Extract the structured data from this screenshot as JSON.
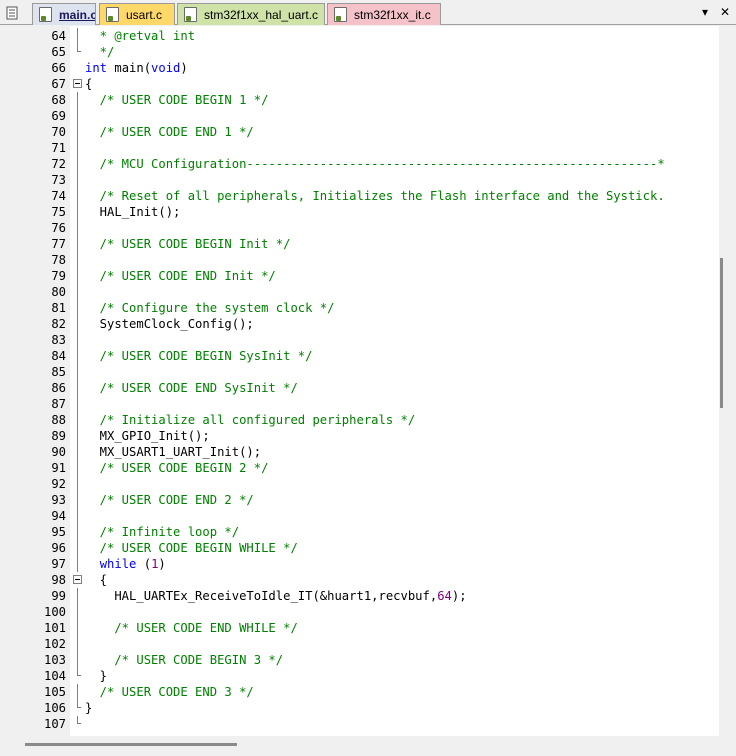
{
  "tabs": [
    {
      "label": "main.c",
      "active": true,
      "color": "#dde3ef"
    },
    {
      "label": "usart.c",
      "active": false,
      "color": "#ffd86a"
    },
    {
      "label": "stm32f1xx_hal_uart.c",
      "active": false,
      "color": "#cfe3a8"
    },
    {
      "label": "stm32f1xx_it.c",
      "active": false,
      "color": "#f4c2c8"
    }
  ],
  "controls": {
    "dropdown_icon": "chevron-down-icon",
    "close_icon": "close-icon",
    "dropdown_glyph": "▾",
    "close_glyph": "✕"
  },
  "colors": {
    "comment": "#008000",
    "keyword": "#0000ff",
    "number": "#800080",
    "text": "#000000"
  },
  "lines": [
    {
      "n": "64",
      "fold": "line",
      "segs": [
        {
          "t": "  * @retval int",
          "c": "cm"
        }
      ]
    },
    {
      "n": "65",
      "fold": "end",
      "segs": [
        {
          "t": "  */",
          "c": "cm"
        }
      ]
    },
    {
      "n": "66",
      "fold": "",
      "segs": [
        {
          "t": "int",
          "c": "kw"
        },
        {
          "t": " main(",
          "c": ""
        },
        {
          "t": "void",
          "c": "kw"
        },
        {
          "t": ")",
          "c": ""
        }
      ]
    },
    {
      "n": "67",
      "fold": "box",
      "segs": [
        {
          "t": "{",
          "c": ""
        }
      ]
    },
    {
      "n": "68",
      "fold": "line",
      "segs": [
        {
          "t": "  /* USER CODE BEGIN 1 */",
          "c": "cm"
        }
      ]
    },
    {
      "n": "69",
      "fold": "line",
      "segs": []
    },
    {
      "n": "70",
      "fold": "line",
      "segs": [
        {
          "t": "  /* USER CODE END 1 */",
          "c": "cm"
        }
      ]
    },
    {
      "n": "71",
      "fold": "line",
      "segs": []
    },
    {
      "n": "72",
      "fold": "line",
      "segs": [
        {
          "t": "  /* MCU Configuration--------------------------------------------------------*",
          "c": "cm"
        }
      ]
    },
    {
      "n": "73",
      "fold": "line",
      "segs": []
    },
    {
      "n": "74",
      "fold": "line",
      "segs": [
        {
          "t": "  /* Reset of all peripherals, Initializes the Flash interface and the Systick.",
          "c": "cm"
        }
      ]
    },
    {
      "n": "75",
      "fold": "line",
      "segs": [
        {
          "t": "  HAL_Init();",
          "c": ""
        }
      ]
    },
    {
      "n": "76",
      "fold": "line",
      "segs": []
    },
    {
      "n": "77",
      "fold": "line",
      "segs": [
        {
          "t": "  /* USER CODE BEGIN Init */",
          "c": "cm"
        }
      ]
    },
    {
      "n": "78",
      "fold": "line",
      "segs": []
    },
    {
      "n": "79",
      "fold": "line",
      "segs": [
        {
          "t": "  /* USER CODE END Init */",
          "c": "cm"
        }
      ]
    },
    {
      "n": "80",
      "fold": "line",
      "segs": []
    },
    {
      "n": "81",
      "fold": "line",
      "segs": [
        {
          "t": "  /* Configure the system clock */",
          "c": "cm"
        }
      ]
    },
    {
      "n": "82",
      "fold": "line",
      "segs": [
        {
          "t": "  SystemClock_Config();",
          "c": ""
        }
      ]
    },
    {
      "n": "83",
      "fold": "line",
      "segs": []
    },
    {
      "n": "84",
      "fold": "line",
      "segs": [
        {
          "t": "  /* USER CODE BEGIN SysInit */",
          "c": "cm"
        }
      ]
    },
    {
      "n": "85",
      "fold": "line",
      "segs": []
    },
    {
      "n": "86",
      "fold": "line",
      "segs": [
        {
          "t": "  /* USER CODE END SysInit */",
          "c": "cm"
        }
      ]
    },
    {
      "n": "87",
      "fold": "line",
      "segs": []
    },
    {
      "n": "88",
      "fold": "line",
      "segs": [
        {
          "t": "  /* Initialize all configured peripherals */",
          "c": "cm"
        }
      ]
    },
    {
      "n": "89",
      "fold": "line",
      "segs": [
        {
          "t": "  MX_GPIO_Init();",
          "c": ""
        }
      ]
    },
    {
      "n": "90",
      "fold": "line",
      "segs": [
        {
          "t": "  MX_USART1_UART_Init();",
          "c": ""
        }
      ]
    },
    {
      "n": "91",
      "fold": "line",
      "segs": [
        {
          "t": "  /* USER CODE BEGIN 2 */",
          "c": "cm"
        }
      ]
    },
    {
      "n": "92",
      "fold": "line",
      "segs": []
    },
    {
      "n": "93",
      "fold": "line",
      "segs": [
        {
          "t": "  /* USER CODE END 2 */",
          "c": "cm"
        }
      ]
    },
    {
      "n": "94",
      "fold": "line",
      "segs": []
    },
    {
      "n": "95",
      "fold": "line",
      "segs": [
        {
          "t": "  /* Infinite loop */",
          "c": "cm"
        }
      ]
    },
    {
      "n": "96",
      "fold": "line",
      "segs": [
        {
          "t": "  /* USER CODE BEGIN WHILE */",
          "c": "cm"
        }
      ]
    },
    {
      "n": "97",
      "fold": "line",
      "segs": [
        {
          "t": "  ",
          "c": ""
        },
        {
          "t": "while",
          "c": "kw"
        },
        {
          "t": " (",
          "c": ""
        },
        {
          "t": "1",
          "c": "nm"
        },
        {
          "t": ")",
          "c": ""
        }
      ]
    },
    {
      "n": "98",
      "fold": "box",
      "segs": [
        {
          "t": "  {",
          "c": ""
        }
      ]
    },
    {
      "n": "99",
      "fold": "line",
      "segs": [
        {
          "t": "    HAL_UARTEx_ReceiveToIdle_IT(&huart1,recvbuf,",
          "c": ""
        },
        {
          "t": "64",
          "c": "nm"
        },
        {
          "t": ");",
          "c": ""
        }
      ]
    },
    {
      "n": "100",
      "fold": "line",
      "segs": []
    },
    {
      "n": "101",
      "fold": "line",
      "segs": [
        {
          "t": "    /* USER CODE END WHILE */",
          "c": "cm"
        }
      ]
    },
    {
      "n": "102",
      "fold": "line",
      "segs": []
    },
    {
      "n": "103",
      "fold": "line",
      "segs": [
        {
          "t": "    /* USER CODE BEGIN 3 */",
          "c": "cm"
        }
      ]
    },
    {
      "n": "104",
      "fold": "end",
      "segs": [
        {
          "t": "  }",
          "c": ""
        }
      ]
    },
    {
      "n": "105",
      "fold": "line",
      "segs": [
        {
          "t": "  /* USER CODE END 3 */",
          "c": "cm"
        }
      ]
    },
    {
      "n": "106",
      "fold": "end",
      "segs": [
        {
          "t": "}",
          "c": ""
        }
      ]
    },
    {
      "n": "107",
      "fold": "end",
      "segs": []
    }
  ]
}
